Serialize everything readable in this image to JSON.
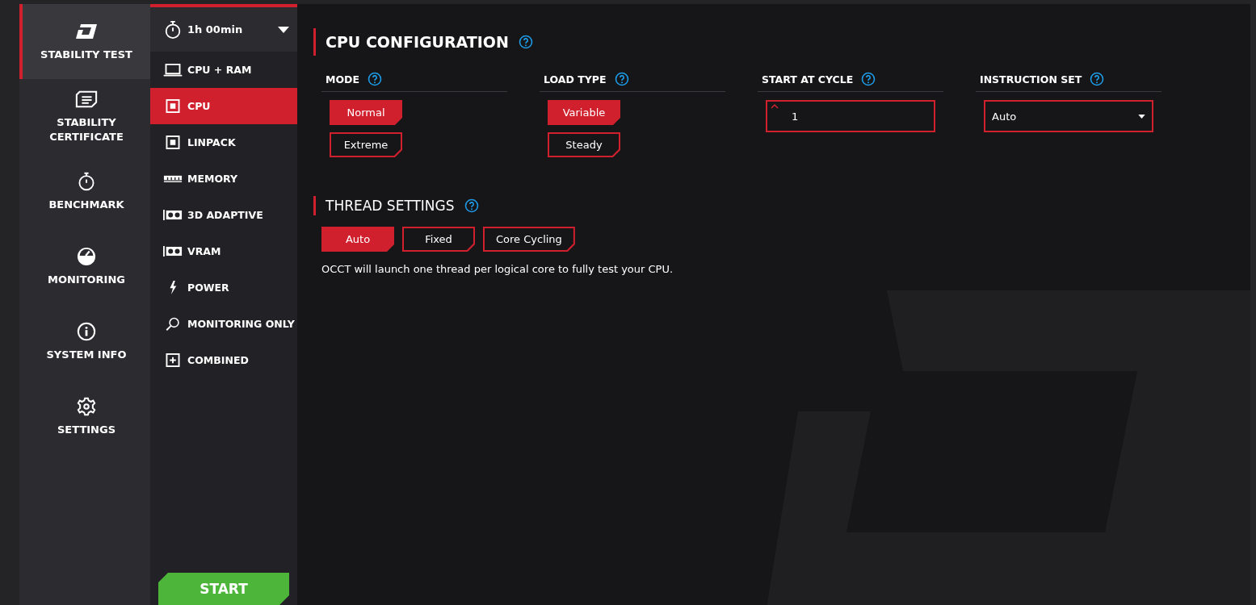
{
  "nav": [
    {
      "label": "STABILITY TEST",
      "selected": true
    },
    {
      "label": "STABILITY CERTIFICATE",
      "selected": false
    },
    {
      "label": "BENCHMARK",
      "selected": false
    },
    {
      "label": "MONITORING",
      "selected": false
    },
    {
      "label": "SYSTEM INFO",
      "selected": false
    },
    {
      "label": "SETTINGS",
      "selected": false
    }
  ],
  "duration": {
    "value": "1h 00min"
  },
  "tests": [
    {
      "label": "CPU + RAM",
      "selected": false
    },
    {
      "label": "CPU",
      "selected": true
    },
    {
      "label": "LINPACK",
      "selected": false
    },
    {
      "label": "MEMORY",
      "selected": false
    },
    {
      "label": "3D ADAPTIVE",
      "selected": false
    },
    {
      "label": "VRAM",
      "selected": false
    },
    {
      "label": "POWER",
      "selected": false
    },
    {
      "label": "MONITORING ONLY",
      "selected": false
    },
    {
      "label": "COMBINED",
      "selected": false
    }
  ],
  "start_button": "START",
  "cpu_configuration": {
    "title": "CPU CONFIGURATION",
    "fields": [
      {
        "label": "MODE",
        "kind": "options",
        "options": [
          {
            "label": "Normal",
            "selected": true
          },
          {
            "label": "Extreme",
            "selected": false
          }
        ]
      },
      {
        "label": "LOAD TYPE",
        "kind": "options",
        "options": [
          {
            "label": "Variable",
            "selected": true
          },
          {
            "label": "Steady",
            "selected": false
          }
        ]
      },
      {
        "label": "START AT CYCLE",
        "kind": "number",
        "value": "1"
      },
      {
        "label": "INSTRUCTION SET",
        "kind": "select",
        "value": "Auto"
      }
    ]
  },
  "thread_settings": {
    "title": "THREAD SETTINGS",
    "options": [
      {
        "label": "Auto",
        "selected": true
      },
      {
        "label": "Fixed",
        "selected": false
      },
      {
        "label": "Core Cycling",
        "selected": false
      }
    ],
    "description": "OCCT will launch one thread per logical core to fully test your CPU."
  }
}
